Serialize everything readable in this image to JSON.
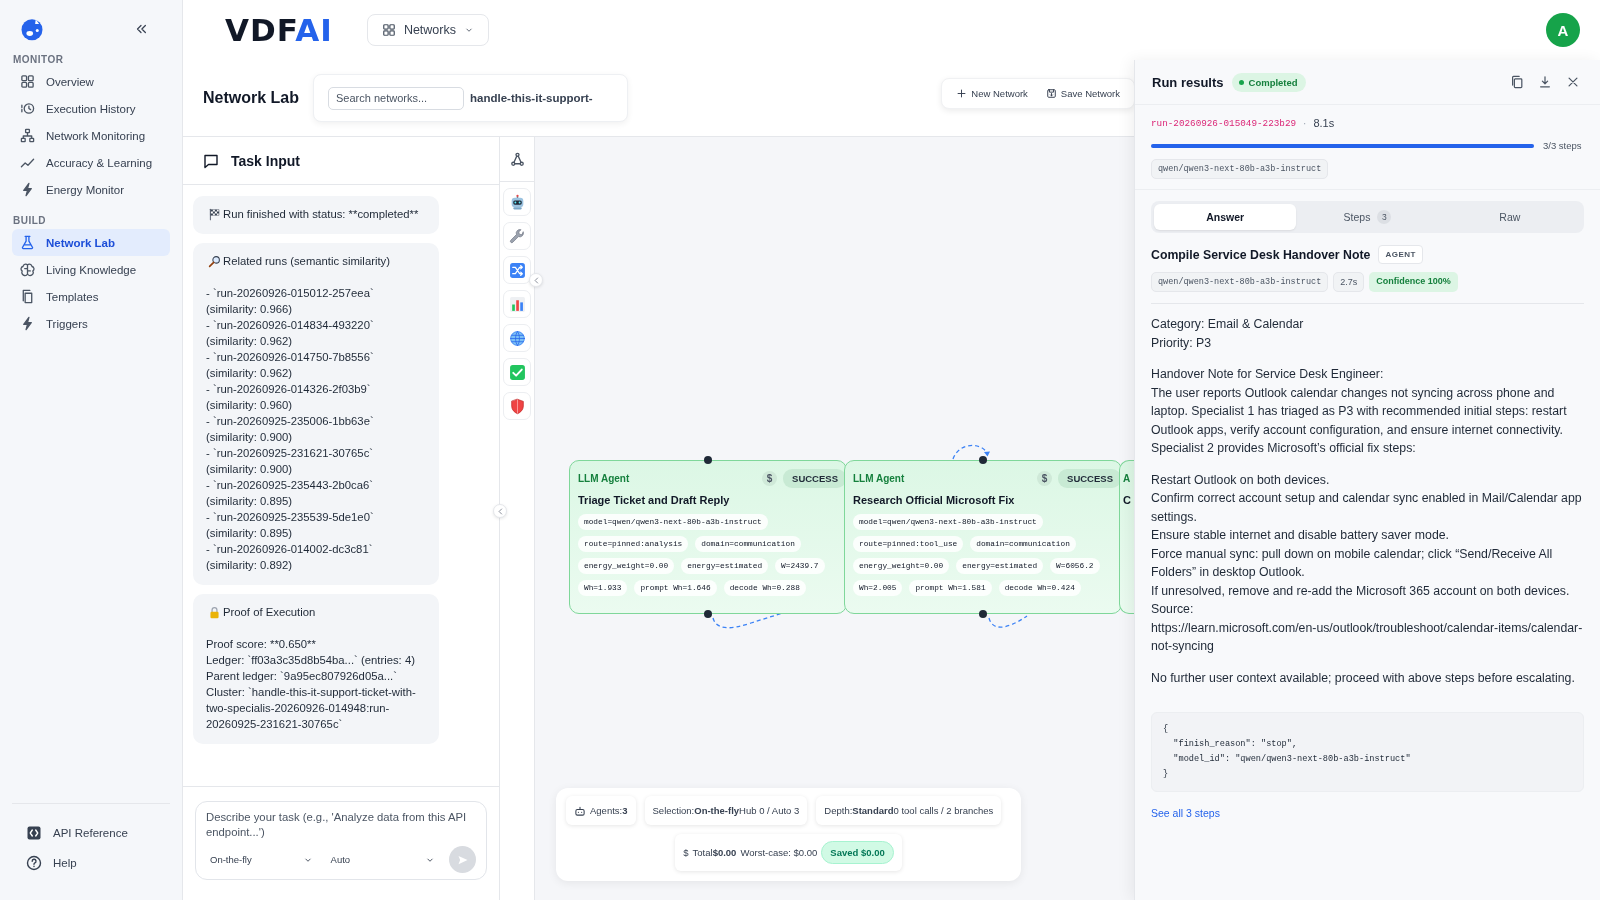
{
  "sidebar": {
    "sections": [
      {
        "heading": "MONITOR",
        "items": [
          {
            "label": "Overview",
            "selected": false
          },
          {
            "label": "Execution History",
            "selected": false
          },
          {
            "label": "Network Monitoring",
            "selected": false
          },
          {
            "label": "Accuracy & Learning",
            "selected": false
          },
          {
            "label": "Energy Monitor",
            "selected": false
          }
        ]
      },
      {
        "heading": "BUILD",
        "items": [
          {
            "label": "Network Lab",
            "selected": true
          },
          {
            "label": "Living Knowledge",
            "selected": false
          },
          {
            "label": "Templates",
            "selected": false
          },
          {
            "label": "Triggers",
            "selected": false
          }
        ]
      }
    ],
    "footer": [
      "API Reference",
      "Help"
    ]
  },
  "header": {
    "logo": {
      "text": "VDF",
      "accent": "AI"
    },
    "menu": "Networks",
    "avatar": "A"
  },
  "page": {
    "title": "Network Lab",
    "search": {
      "placeholder": "Search networks..."
    },
    "current_network": "handle-this-it-support-",
    "actions": [
      "New Network",
      "Save Network"
    ]
  },
  "task_input": {
    "title": "Task Input",
    "messages": [
      {
        "kind": "status",
        "heading": "Run finished with status: **completed**"
      },
      {
        "kind": "related",
        "heading": "Related runs (semantic similarity)",
        "body": "- `run-20260926-015012-257eea`\n(similarity: 0.966)\n- `run-20260926-014834-493220`\n(similarity: 0.962)\n- `run-20260926-014750-7b8556`\n(similarity: 0.962)\n- `run-20260926-014326-2f03b9`\n(similarity: 0.960)\n- `run-20260925-235006-1bb63e`\n(similarity: 0.900)\n- `run-20260925-231621-30765c`\n(similarity: 0.900)\n- `run-20260925-235443-2b0ca6`\n(similarity: 0.895)\n- `run-20260925-235539-5de1e0`\n(similarity: 0.895)\n- `run-20260926-014002-dc3c81`\n(similarity: 0.892)"
      },
      {
        "kind": "proof",
        "heading": "Proof of Execution",
        "body": "Proof score: **0.650**\nLedger: `ff03a3c35d8b54ba...` (entries: 4)\nParent ledger: `9a95ec807926d05a...`\nCluster: `handle-this-it-support-ticket-with-two-specialis-20260926-014948:run-20260925-231621-30765c`"
      }
    ],
    "composer": {
      "placeholder": "Describe your task (e.g., 'Analyze data from this API endpoint...')",
      "selects": [
        "On-the-fly",
        "Auto"
      ],
      "send_disabled": true
    }
  },
  "canvas": {
    "nodes": [
      {
        "type": "LLM Agent",
        "cost": "$",
        "status": "SUCCESS",
        "title": "Triage Ticket and Draft Reply",
        "tags": [
          [
            "model=qwen/qwen3-next-80b-a3b-instruct"
          ],
          [
            "route=pinned:analysis",
            "domain=communication"
          ],
          [
            "energy_weight=0.00",
            "energy=estimated",
            "W=2439.7"
          ],
          [
            "Wh=1.933",
            "prompt Wh=1.646",
            "decode Wh=0.288"
          ]
        ]
      },
      {
        "type": "LLM Agent",
        "cost": "$",
        "status": "SUCCESS",
        "title": "Research Official Microsoft Fix",
        "tags": [
          [
            "model=qwen/qwen3-next-80b-a3b-instruct"
          ],
          [
            "route=pinned:tool_use",
            "domain=communication"
          ],
          [
            "energy_weight=0.00",
            "energy=estimated",
            "W=6056.2"
          ],
          [
            "Wh=2.005",
            "prompt Wh=1.581",
            "decode Wh=0.424"
          ]
        ]
      },
      {
        "type": "A",
        "title": "C"
      }
    ],
    "summary": {
      "chips": [
        {
          "kind": "agents",
          "text": "Agents:**3**"
        },
        {
          "kind": "selection",
          "text": "Selection:**On-the-fly**Hub 0 / Auto 3"
        },
        {
          "kind": "depth",
          "text": "Depth:**Standard**0 tool calls / 2 branches"
        }
      ],
      "cost": {
        "currency": "$",
        "total": "Total**$0.00**",
        "worst_case": "Worst-case: $0.00",
        "saved": "Saved $0.00"
      }
    }
  },
  "run_panel": {
    "title": "Run results",
    "status": "Completed",
    "run_id": "run-20260926-015049-223b29",
    "separator": "·",
    "duration": "8.1s",
    "progress": {
      "level": 1,
      "label": "3/3 steps"
    },
    "model": "qwen/qwen3-next-80b-a3b-instruct",
    "tabs": [
      {
        "label": "Answer",
        "selected": true
      },
      {
        "label": "Steps",
        "count": "3",
        "selected": false
      },
      {
        "label": "Raw",
        "selected": false
      }
    ],
    "answer": {
      "title": "Compile Service Desk Handover Note",
      "badge": "AGENT",
      "model": "qwen/qwen3-next-80b-a3b-instruct",
      "duration": "2.7s",
      "confidence": "Confidence 100%",
      "paragraphs": [
        "Category: Email & Calendar\nPriority: P3",
        "Handover Note for Service Desk Engineer:\nThe user reports Outlook calendar changes not syncing across phone and laptop. Specialist 1 has triaged as P3 with recommended initial steps: restart Outlook apps, verify account configuration, and ensure internet connectivity.\nSpecialist 2 provides Microsoft’s official fix steps:",
        "Restart Outlook on both devices.\nConfirm correct account setup and calendar sync enabled in Mail/Calendar app settings.\nEnsure stable internet and disable battery saver mode.\nForce manual sync: pull down on mobile calendar; click “Send/Receive All Folders” in desktop Outlook.\nIf unresolved, remove and re-add the Microsoft 365 account on both devices.\nSource:\nhttps://learn.microsoft.com/en-us/outlook/troubleshoot/calendar-items/calendar-not-syncing",
        "No further user context available; proceed with above steps before escalating."
      ],
      "code": "{\n  \"finish_reason\": \"stop\",\n  \"model_id\": \"qwen/qwen3-next-80b-a3b-instruct\"\n}",
      "link": "See all 3 steps"
    }
  }
}
